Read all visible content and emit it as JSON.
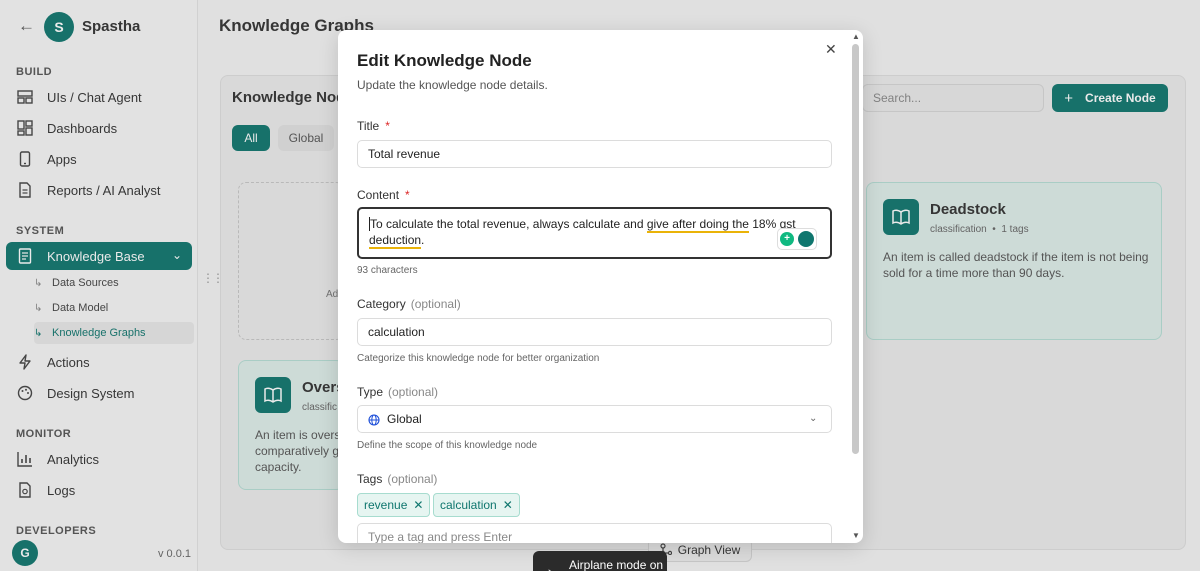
{
  "sidebar": {
    "brand_initial": "S",
    "brand_name": "Spastha",
    "sections": {
      "build": "BUILD",
      "system": "SYSTEM",
      "monitor": "MONITOR",
      "developers": "DEVELOPERS"
    },
    "items": {
      "uis_chat_agent": "UIs / Chat Agent",
      "dashboards": "Dashboards",
      "apps": "Apps",
      "reports": "Reports / AI Analyst",
      "knowledge_base": "Knowledge Base",
      "actions": "Actions",
      "design_system": "Design System",
      "analytics": "Analytics",
      "logs": "Logs"
    },
    "sub_items": {
      "data_sources": "Data Sources",
      "data_model": "Data Model",
      "knowledge_graphs": "Knowledge Graphs"
    },
    "user_initial": "G",
    "version": "v 0.0.1"
  },
  "main": {
    "page_title": "Knowledge Graphs",
    "panel_title": "Knowledge Nod",
    "filters": {
      "all": "All",
      "global": "Global"
    },
    "search_placeholder": "Search...",
    "create_button": "Create Node",
    "add_card_text": "Ad",
    "cards": [
      {
        "title": "Overs",
        "meta": "classific",
        "desc_lines": [
          "An item is overst",
          "comparatively g",
          "capacity."
        ]
      },
      {
        "title": "Deadstock",
        "category": "classification",
        "tags_count": "1 tags",
        "desc_lines": [
          "An item is called deadstock if the item is not being",
          "sold for a time more than 90 days."
        ]
      }
    ],
    "graph_view_button": "Graph View"
  },
  "modal": {
    "title": "Edit Knowledge Node",
    "subtitle": "Update the knowledge node details.",
    "title_label": "Title",
    "title_required": "*",
    "title_value": "Total revenue",
    "content_label": "Content",
    "content_required": "*",
    "content_part1": "To calculate the total revenue, always calculate and ",
    "content_underlined": "give after doing the",
    "content_part2": " 18% gst",
    "content_underlined2": "deduction",
    "content_part3": ".",
    "char_count": "93 characters",
    "category_label": "Category",
    "category_optional": "(optional)",
    "category_value": "calculation",
    "category_hint": "Categorize this knowledge node for better organization",
    "type_label": "Type",
    "type_optional": "(optional)",
    "type_value": "Global",
    "type_hint": "Define the scope of this knowledge node",
    "tags_label": "Tags",
    "tags_optional": "(optional)",
    "tags": [
      "revenue",
      "calculation"
    ],
    "tag_input_placeholder": "Type a tag and press Enter"
  },
  "toast": {
    "text": "Airplane mode on"
  },
  "colors": {
    "accent": "#0f766e",
    "required": "#dc2626",
    "spell_underline": "#eab308"
  }
}
